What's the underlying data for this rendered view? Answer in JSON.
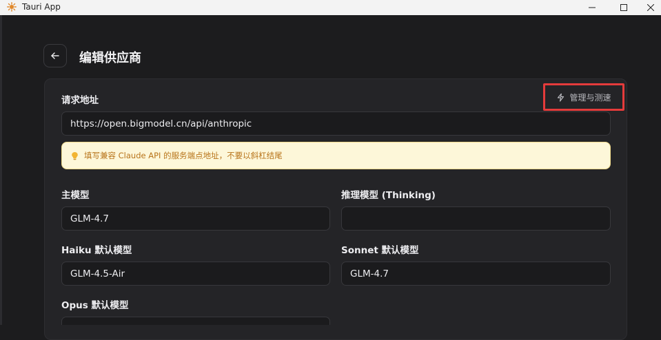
{
  "window": {
    "title": "Tauri App"
  },
  "header": {
    "title": "编辑供应商"
  },
  "form": {
    "request_url": {
      "label": "请求地址",
      "value": "https://open.bigmodel.cn/api/anthropic"
    },
    "manage_button": {
      "label": "管理与测速",
      "icon": "lightning-icon"
    },
    "hint": {
      "icon": "lightbulb-icon",
      "text": "填写兼容 Claude API 的服务端点地址，不要以斜杠结尾"
    },
    "main_model": {
      "label": "主模型",
      "value": "GLM-4.7"
    },
    "reasoning_model": {
      "label": "推理模型 (Thinking)",
      "value": ""
    },
    "haiku_model": {
      "label": "Haiku 默认模型",
      "value": "GLM-4.5-Air"
    },
    "sonnet_model": {
      "label": "Sonnet 默认模型",
      "value": "GLM-4.7"
    },
    "opus_model": {
      "label": "Opus 默认模型",
      "value": ""
    }
  },
  "colors": {
    "highlight_border": "#e53b3b",
    "hint_background": "#fdf7d9",
    "hint_text": "#b8741a"
  }
}
